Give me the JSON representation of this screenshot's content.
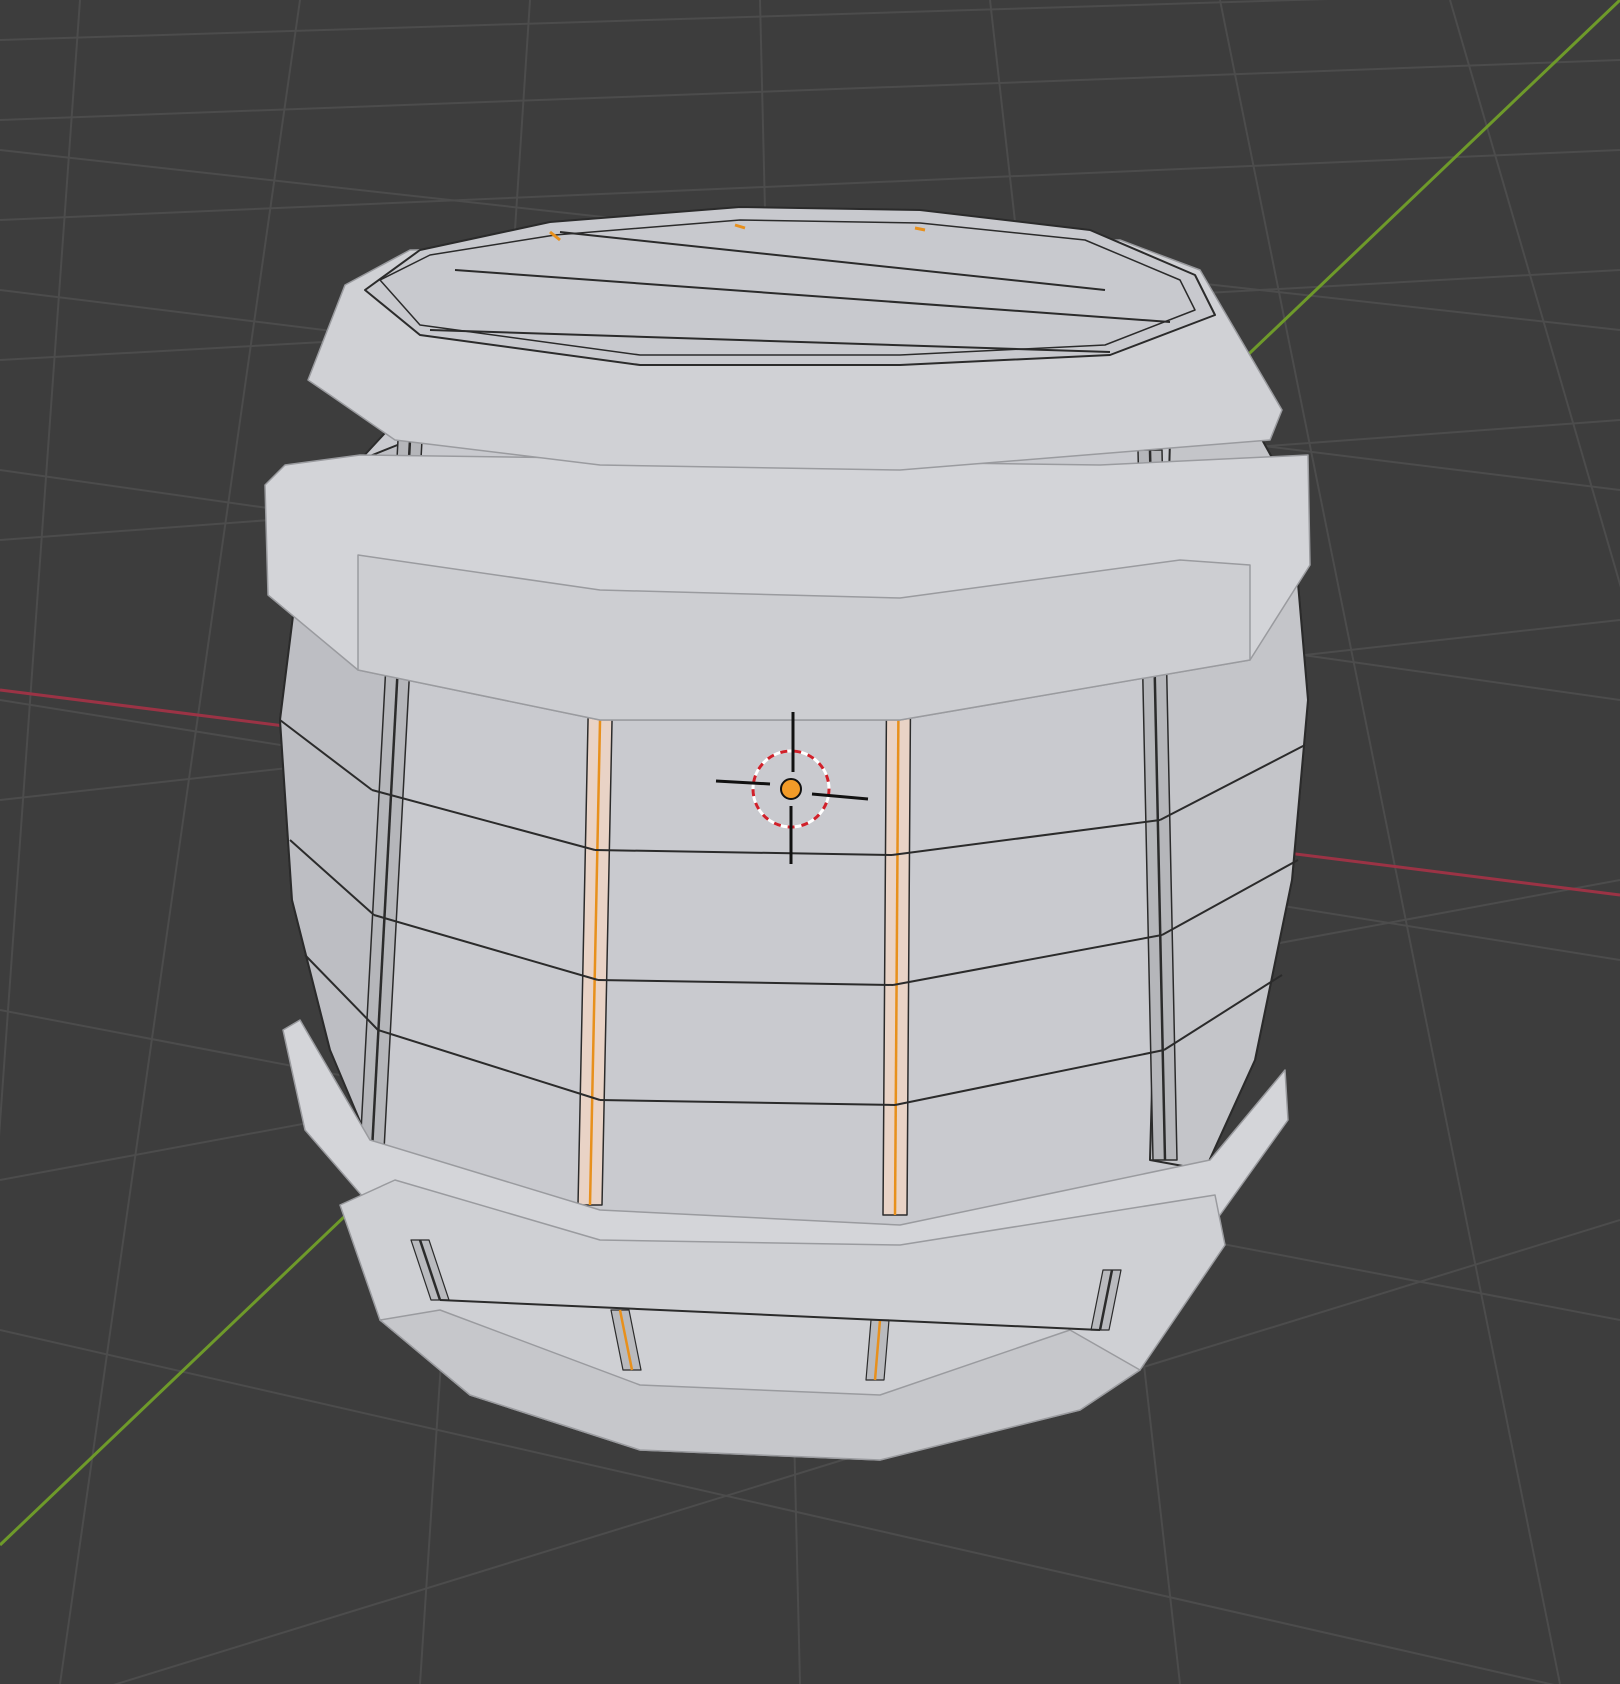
{
  "viewport": {
    "background": "#3d3d3d",
    "grid_color": "#4c4c4c",
    "x_axis_color": "#9b3345",
    "y_axis_color": "#6e9a2a"
  },
  "object": {
    "type": "barrel",
    "mode": "edit",
    "surface_color": "#c8c9cd",
    "wire_color": "#2b2b2b",
    "selected_edge_color": "#e8901c"
  },
  "cursor_3d": {
    "ring_colors": [
      "#ffffff",
      "#d0202a"
    ],
    "crosshair_color": "#111111"
  },
  "origin": {
    "color": "#f29b28"
  }
}
